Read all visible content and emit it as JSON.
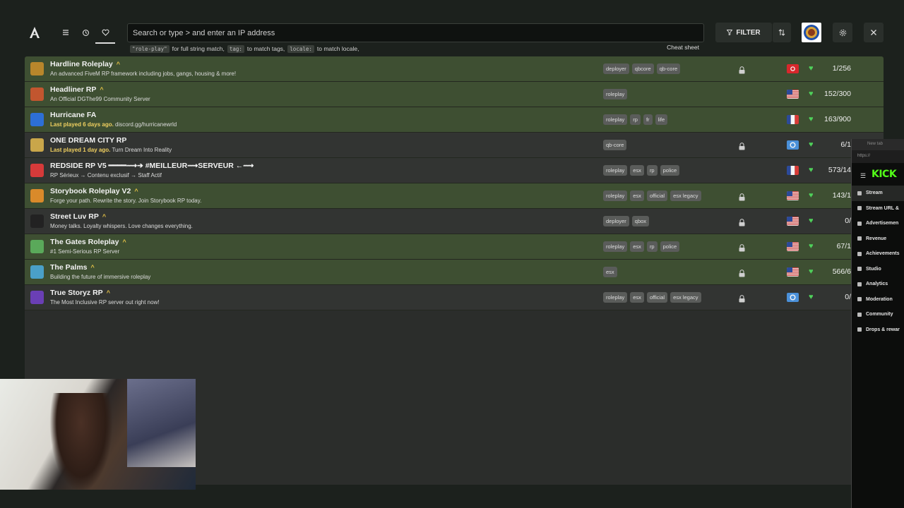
{
  "topbar": {
    "search_placeholder": "Search or type > and enter an IP address",
    "hint_code_1": "\"role-play\"",
    "hint_text_1": "for full string match,",
    "hint_code_2": "tag:",
    "hint_text_2": "to match tags,",
    "hint_code_3": "locale:",
    "hint_text_3": "to match locale,",
    "cheat_sheet": "Cheat sheet",
    "filter_label": "FILTER"
  },
  "servers": [
    {
      "name": "Hardline Roleplay",
      "boost": "^",
      "last_played": "",
      "desc": "An advanced FiveM RP framework including jobs, gangs, housing & more!",
      "tags": [
        "deployer",
        "qbcore",
        "qb-core"
      ],
      "locked": true,
      "flag": "tn",
      "players": "1/256",
      "icon_color": "#b8862b",
      "style": "green"
    },
    {
      "name": "Headliner RP",
      "boost": "^",
      "last_played": "",
      "desc": "An Official DGThe99 Community Server",
      "tags": [
        "roleplay"
      ],
      "locked": false,
      "flag": "us",
      "players": "152/300",
      "icon_color": "#c2562f",
      "style": "green"
    },
    {
      "name": "Hurricane FA",
      "boost": "",
      "last_played": "Last played 6 days ago.",
      "desc": "discord.gg/hurricanewrld",
      "tags": [
        "roleplay",
        "rp",
        "fr",
        "life"
      ],
      "locked": false,
      "flag": "fr",
      "players": "163/900",
      "icon_color": "#2d6fd6",
      "style": "green"
    },
    {
      "name": "ONE DREAM CITY RP",
      "boost": "",
      "last_played": "Last played 1 day ago.",
      "desc": "Turn Dream Into Reality",
      "tags": [
        "qb-core"
      ],
      "locked": true,
      "flag": "globe",
      "players": "6/1",
      "icon_color": "#c9a64a",
      "style": "dark"
    },
    {
      "name": "REDSIDE RP V5 ━━━━⟿➔ #MEILLEUR⟿SERVEUR ←⟿",
      "boost": "",
      "last_played": "",
      "desc": "RP Sérieux → Contenu exclusif → Staff Actif",
      "tags": [
        "roleplay",
        "esx",
        "rp",
        "police"
      ],
      "locked": false,
      "flag": "fr",
      "players": "573/14",
      "icon_color": "#d63a3a",
      "style": "dark"
    },
    {
      "name": "Storybook Roleplay V2",
      "boost": "^",
      "last_played": "",
      "desc": "Forge your path. Rewrite the story. Join Storybook RP today.",
      "tags": [
        "roleplay",
        "esx",
        "official",
        "esx legacy"
      ],
      "locked": true,
      "flag": "us",
      "players": "143/1",
      "icon_color": "#d98a2a",
      "style": "green"
    },
    {
      "name": "Street Luv RP",
      "boost": "^",
      "last_played": "",
      "desc": "Money talks. Loyalty whispers. Love changes everything.",
      "tags": [
        "deployer",
        "qbox"
      ],
      "locked": true,
      "flag": "us",
      "players": "0/",
      "icon_color": "#222222",
      "style": "dark"
    },
    {
      "name": "The Gates Roleplay",
      "boost": "^",
      "last_played": "",
      "desc": "#1 Semi-Serious RP Server",
      "tags": [
        "roleplay",
        "esx",
        "rp",
        "police"
      ],
      "locked": true,
      "flag": "us",
      "players": "67/1",
      "icon_color": "#5aa95a",
      "style": "green"
    },
    {
      "name": "The Palms",
      "boost": "^",
      "last_played": "",
      "desc": "Building the future of immersive roleplay",
      "tags": [
        "esx"
      ],
      "locked": true,
      "flag": "us",
      "players": "566/6",
      "icon_color": "#4aa0c8",
      "style": "green"
    },
    {
      "name": "True Storyz RP",
      "boost": "^",
      "last_played": "",
      "desc": "The Most Inclusive RP server out right now!",
      "tags": [
        "roleplay",
        "esx",
        "official",
        "esx legacy"
      ],
      "locked": true,
      "flag": "globe",
      "players": "0/",
      "icon_color": "#6a3fb5",
      "style": "dark"
    }
  ],
  "side_browser": {
    "tab_label": "New tab",
    "url": "https://",
    "brand": "KICK",
    "items": [
      "Stream",
      "Stream URL &",
      "Advertisemen",
      "Revenue",
      "Achievements",
      "Studio",
      "Analytics",
      "Moderation",
      "Community",
      "Drops & rewar"
    ]
  },
  "colors": {
    "accent_green": "#4fd05a",
    "brand_kick": "#53fc18",
    "boost_gold": "#e8c547"
  }
}
